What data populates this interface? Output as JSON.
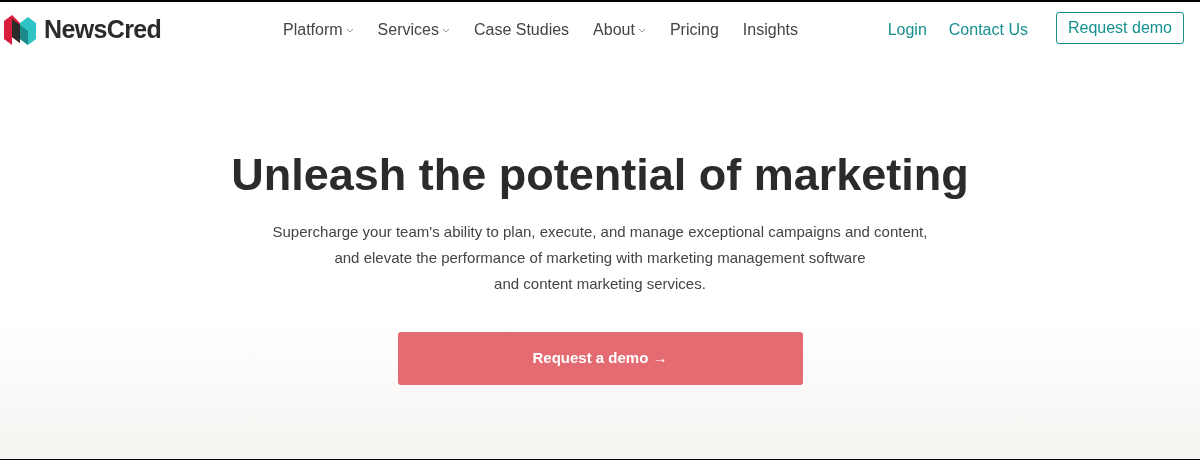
{
  "brand": {
    "name": "NewsCred"
  },
  "nav": [
    {
      "label": "Platform",
      "has_menu": true
    },
    {
      "label": "Services",
      "has_menu": true
    },
    {
      "label": "Case Studies",
      "has_menu": false
    },
    {
      "label": "About",
      "has_menu": true
    },
    {
      "label": "Pricing",
      "has_menu": false
    },
    {
      "label": "Insights",
      "has_menu": false
    }
  ],
  "links": [
    "Login",
    "Contact Us"
  ],
  "header_button": "Request demo",
  "hero": {
    "title": "Unleash the potential of marketing",
    "lines": [
      "Supercharge your team's ability to plan, execute, and manage exceptional campaigns and content,",
      "and elevate the performance of marketing with marketing management software",
      "and content marketing services."
    ],
    "button": "Request a demo →"
  }
}
